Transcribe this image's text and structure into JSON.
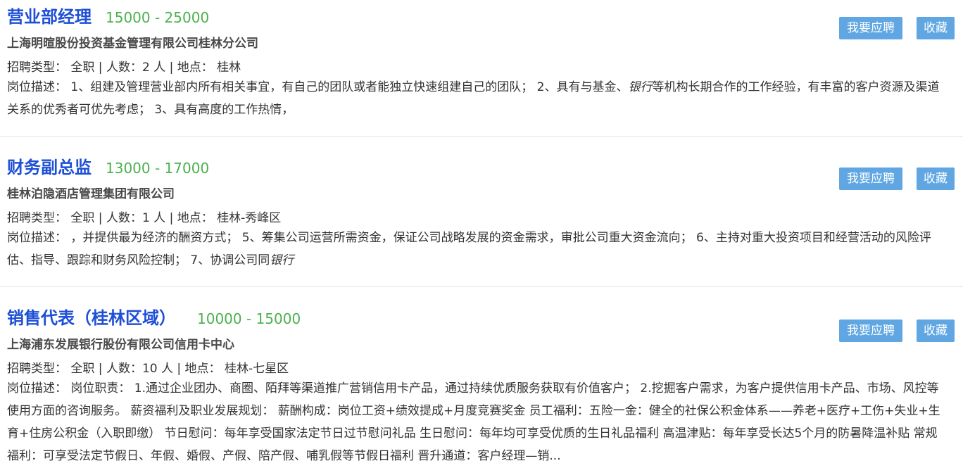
{
  "labels": {
    "apply": "我要应聘",
    "favorite": "收藏",
    "type_prefix": "招聘类型：",
    "count_prefix": "人数：",
    "location_prefix": "地点：",
    "desc_prefix": "岗位描述："
  },
  "jobs": [
    {
      "title": "营业部经理",
      "salary": "15000 - 25000",
      "company": "上海明暄股份投资基金管理有限公司桂林分公司",
      "type": "全职",
      "count": "2 人",
      "location": "桂林",
      "desc_before": "1、组建及管理营业部内所有相关事宜，有自己的团队或者能独立快速组建自己的团队； 2、具有与基金、",
      "desc_em": "银行",
      "desc_after": "等机构长期合作的工作经验，有丰富的客户资源及渠道关系的优秀者可优先考虑； 3、具有高度的工作热情，"
    },
    {
      "title": "财务副总监",
      "salary": "13000 - 17000",
      "company": "桂林泊隐酒店管理集团有限公司",
      "type": "全职",
      "count": "1 人",
      "location": "桂林-秀峰区",
      "desc_before": "，并提供最为经济的酬资方式； 5、筹集公司运营所需资金，保证公司战略发展的资金需求，审批公司重大资金流向； 6、主持对重大投资项目和经营活动的风险评估、指导、跟踪和财务风险控制； 7、协调公司同",
      "desc_em": "银行",
      "desc_after": ""
    },
    {
      "title": "销售代表（桂林区域）",
      "salary": "10000 - 15000",
      "company": "上海浦东发展银行股份有限公司信用卡中心",
      "type": "全职",
      "count": "10 人",
      "location": "桂林-七星区",
      "desc_before": "岗位职责： 1.通过企业团办、商圈、陌拜等渠道推广营销信用卡产品，通过持续优质服务获取有价值客户； 2.挖掘客户需求，为客户提供信用卡产品、市场、风控等使用方面的咨询服务。 薪资福利及职业发展规划： 薪酬构成：岗位工资+绩效提成+月度竞赛奖金 员工福利：五险一金：健全的社保公积金体系——养老+医疗+工伤+失业+生育+住房公积金（入职即缴） 节日慰问：每年享受国家法定节日过节慰问礼品 生日慰问：每年均可享受优质的生日礼品福利 高温津贴：每年享受长达5个月的防暑降温补贴 常规福利：可享受法定节假日、年假、婚假、产假、陪产假、哺乳假等节假日福利 晋升通道：客户经理—销...",
      "desc_em": "",
      "desc_after": ""
    }
  ]
}
